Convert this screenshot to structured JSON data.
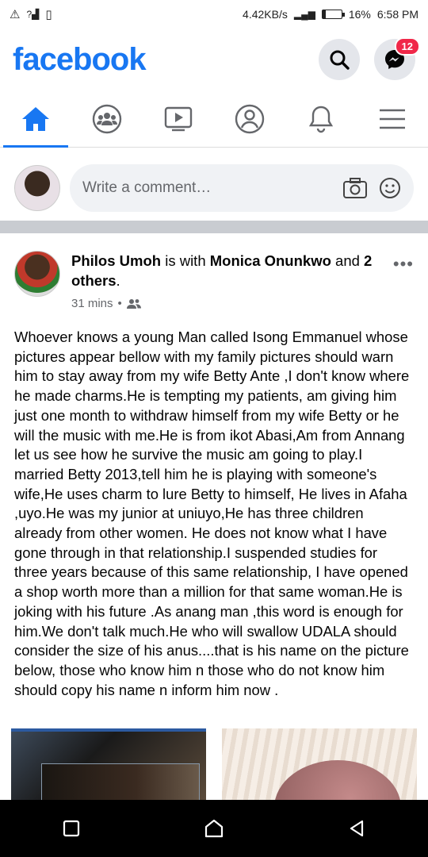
{
  "status_bar": {
    "speed": "4.42KB/s",
    "battery": "16%",
    "time": "6:58 PM"
  },
  "header": {
    "logo": "facebook",
    "messenger_badge": "12"
  },
  "nav": {
    "tabs": [
      "home",
      "groups",
      "watch",
      "profile",
      "notifications",
      "menu"
    ],
    "active": "home"
  },
  "comment": {
    "placeholder": "Write a comment…"
  },
  "post": {
    "author": "Philos Umoh",
    "with_word": "is with",
    "tagged": "Monica Onunkwo",
    "and_word": "and",
    "others": "2 others",
    "time": "31 mins",
    "dot": "•",
    "body": "Whoever knows a young Man called Isong Emmanuel whose pictures appear bellow with my family pictures should warn him to stay away from my wife Betty Ante ,I don't know where he made charms.He is tempting my patients, am giving him just one month to withdraw himself from my wife Betty or he will the music with me.He is from ikot Abasi,Am from Annang let us see how he survive the music am going to play.I married Betty 2013,tell him he is playing with someone's wife,He uses charm to lure Betty to himself, He lives in Afaha ,uyo.He was my junior at uniuyo,He has three children already from other women. He does not know what I have gone through in that relationship.I suspended studies for three years because of this same relationship, I have opened a shop worth more than a million for that same woman.He is joking with his future .As anang man ,this word is enough for him.We don't talk much.He who will swallow UDALA should consider the size of his anus....that is his name on the picture below, those who know him n those who do not know him should copy his name n inform him now ."
  },
  "colors": {
    "brand": "#1877f2",
    "badge": "#f02849"
  }
}
